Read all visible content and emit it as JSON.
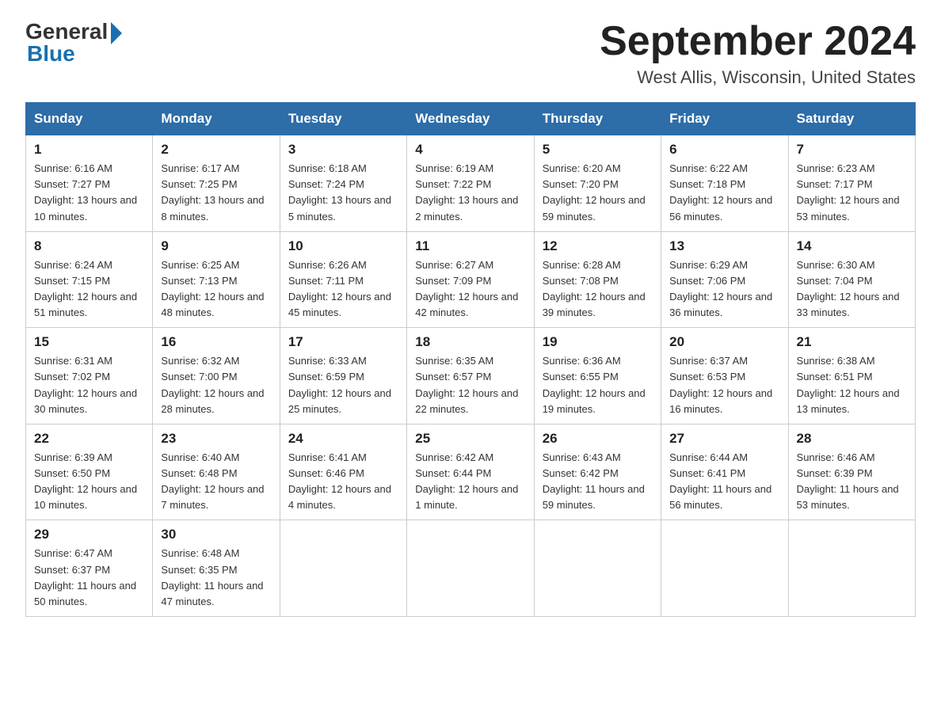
{
  "logo": {
    "general": "General",
    "blue": "Blue"
  },
  "title": "September 2024",
  "subtitle": "West Allis, Wisconsin, United States",
  "days_of_week": [
    "Sunday",
    "Monday",
    "Tuesday",
    "Wednesday",
    "Thursday",
    "Friday",
    "Saturday"
  ],
  "weeks": [
    [
      {
        "day": "1",
        "sunrise": "6:16 AM",
        "sunset": "7:27 PM",
        "daylight": "13 hours and 10 minutes."
      },
      {
        "day": "2",
        "sunrise": "6:17 AM",
        "sunset": "7:25 PM",
        "daylight": "13 hours and 8 minutes."
      },
      {
        "day": "3",
        "sunrise": "6:18 AM",
        "sunset": "7:24 PM",
        "daylight": "13 hours and 5 minutes."
      },
      {
        "day": "4",
        "sunrise": "6:19 AM",
        "sunset": "7:22 PM",
        "daylight": "13 hours and 2 minutes."
      },
      {
        "day": "5",
        "sunrise": "6:20 AM",
        "sunset": "7:20 PM",
        "daylight": "12 hours and 59 minutes."
      },
      {
        "day": "6",
        "sunrise": "6:22 AM",
        "sunset": "7:18 PM",
        "daylight": "12 hours and 56 minutes."
      },
      {
        "day": "7",
        "sunrise": "6:23 AM",
        "sunset": "7:17 PM",
        "daylight": "12 hours and 53 minutes."
      }
    ],
    [
      {
        "day": "8",
        "sunrise": "6:24 AM",
        "sunset": "7:15 PM",
        "daylight": "12 hours and 51 minutes."
      },
      {
        "day": "9",
        "sunrise": "6:25 AM",
        "sunset": "7:13 PM",
        "daylight": "12 hours and 48 minutes."
      },
      {
        "day": "10",
        "sunrise": "6:26 AM",
        "sunset": "7:11 PM",
        "daylight": "12 hours and 45 minutes."
      },
      {
        "day": "11",
        "sunrise": "6:27 AM",
        "sunset": "7:09 PM",
        "daylight": "12 hours and 42 minutes."
      },
      {
        "day": "12",
        "sunrise": "6:28 AM",
        "sunset": "7:08 PM",
        "daylight": "12 hours and 39 minutes."
      },
      {
        "day": "13",
        "sunrise": "6:29 AM",
        "sunset": "7:06 PM",
        "daylight": "12 hours and 36 minutes."
      },
      {
        "day": "14",
        "sunrise": "6:30 AM",
        "sunset": "7:04 PM",
        "daylight": "12 hours and 33 minutes."
      }
    ],
    [
      {
        "day": "15",
        "sunrise": "6:31 AM",
        "sunset": "7:02 PM",
        "daylight": "12 hours and 30 minutes."
      },
      {
        "day": "16",
        "sunrise": "6:32 AM",
        "sunset": "7:00 PM",
        "daylight": "12 hours and 28 minutes."
      },
      {
        "day": "17",
        "sunrise": "6:33 AM",
        "sunset": "6:59 PM",
        "daylight": "12 hours and 25 minutes."
      },
      {
        "day": "18",
        "sunrise": "6:35 AM",
        "sunset": "6:57 PM",
        "daylight": "12 hours and 22 minutes."
      },
      {
        "day": "19",
        "sunrise": "6:36 AM",
        "sunset": "6:55 PM",
        "daylight": "12 hours and 19 minutes."
      },
      {
        "day": "20",
        "sunrise": "6:37 AM",
        "sunset": "6:53 PM",
        "daylight": "12 hours and 16 minutes."
      },
      {
        "day": "21",
        "sunrise": "6:38 AM",
        "sunset": "6:51 PM",
        "daylight": "12 hours and 13 minutes."
      }
    ],
    [
      {
        "day": "22",
        "sunrise": "6:39 AM",
        "sunset": "6:50 PM",
        "daylight": "12 hours and 10 minutes."
      },
      {
        "day": "23",
        "sunrise": "6:40 AM",
        "sunset": "6:48 PM",
        "daylight": "12 hours and 7 minutes."
      },
      {
        "day": "24",
        "sunrise": "6:41 AM",
        "sunset": "6:46 PM",
        "daylight": "12 hours and 4 minutes."
      },
      {
        "day": "25",
        "sunrise": "6:42 AM",
        "sunset": "6:44 PM",
        "daylight": "12 hours and 1 minute."
      },
      {
        "day": "26",
        "sunrise": "6:43 AM",
        "sunset": "6:42 PM",
        "daylight": "11 hours and 59 minutes."
      },
      {
        "day": "27",
        "sunrise": "6:44 AM",
        "sunset": "6:41 PM",
        "daylight": "11 hours and 56 minutes."
      },
      {
        "day": "28",
        "sunrise": "6:46 AM",
        "sunset": "6:39 PM",
        "daylight": "11 hours and 53 minutes."
      }
    ],
    [
      {
        "day": "29",
        "sunrise": "6:47 AM",
        "sunset": "6:37 PM",
        "daylight": "11 hours and 50 minutes."
      },
      {
        "day": "30",
        "sunrise": "6:48 AM",
        "sunset": "6:35 PM",
        "daylight": "11 hours and 47 minutes."
      },
      null,
      null,
      null,
      null,
      null
    ]
  ]
}
